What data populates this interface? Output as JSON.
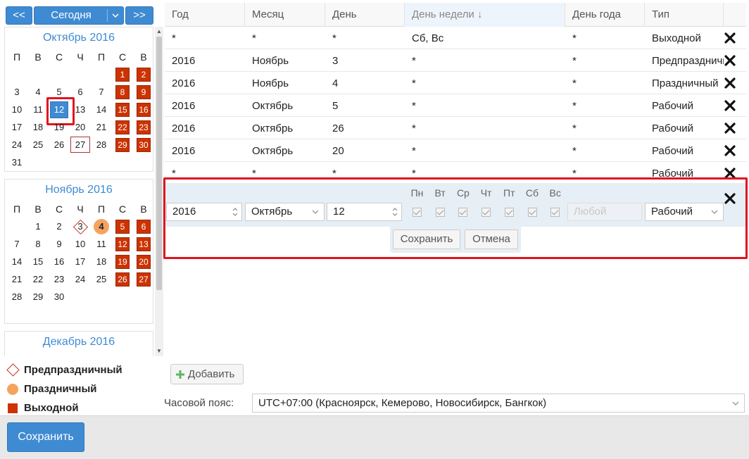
{
  "nav": {
    "prev": "<<",
    "today": "Сегодня",
    "next": ">>"
  },
  "weekday_headers": [
    "П",
    "В",
    "С",
    "Ч",
    "П",
    "С",
    "В"
  ],
  "months": [
    {
      "title": "Октябрь 2016",
      "days": [
        {
          "d": "",
          "t": ""
        },
        {
          "d": "",
          "t": ""
        },
        {
          "d": "",
          "t": ""
        },
        {
          "d": "",
          "t": ""
        },
        {
          "d": "",
          "t": ""
        },
        {
          "d": "1",
          "t": "weekend"
        },
        {
          "d": "2",
          "t": "weekend"
        },
        {
          "d": "3",
          "t": ""
        },
        {
          "d": "4",
          "t": ""
        },
        {
          "d": "5",
          "t": ""
        },
        {
          "d": "6",
          "t": ""
        },
        {
          "d": "7",
          "t": ""
        },
        {
          "d": "8",
          "t": "weekend"
        },
        {
          "d": "9",
          "t": "weekend"
        },
        {
          "d": "10",
          "t": ""
        },
        {
          "d": "11",
          "t": ""
        },
        {
          "d": "12",
          "t": "sel"
        },
        {
          "d": "13",
          "t": ""
        },
        {
          "d": "14",
          "t": ""
        },
        {
          "d": "15",
          "t": "weekend"
        },
        {
          "d": "16",
          "t": "weekend"
        },
        {
          "d": "17",
          "t": ""
        },
        {
          "d": "18",
          "t": ""
        },
        {
          "d": "19",
          "t": ""
        },
        {
          "d": "20",
          "t": ""
        },
        {
          "d": "21",
          "t": ""
        },
        {
          "d": "22",
          "t": "weekend"
        },
        {
          "d": "23",
          "t": "weekend"
        },
        {
          "d": "24",
          "t": ""
        },
        {
          "d": "25",
          "t": ""
        },
        {
          "d": "26",
          "t": ""
        },
        {
          "d": "27",
          "t": "today"
        },
        {
          "d": "28",
          "t": ""
        },
        {
          "d": "29",
          "t": "weekend"
        },
        {
          "d": "30",
          "t": "weekend"
        },
        {
          "d": "31",
          "t": ""
        }
      ]
    },
    {
      "title": "Ноябрь 2016",
      "days": [
        {
          "d": "",
          "t": ""
        },
        {
          "d": "1",
          "t": ""
        },
        {
          "d": "2",
          "t": ""
        },
        {
          "d": "3",
          "t": "preh"
        },
        {
          "d": "4",
          "t": "holi"
        },
        {
          "d": "5",
          "t": "weekend"
        },
        {
          "d": "6",
          "t": "weekend"
        },
        {
          "d": "7",
          "t": ""
        },
        {
          "d": "8",
          "t": ""
        },
        {
          "d": "9",
          "t": ""
        },
        {
          "d": "10",
          "t": ""
        },
        {
          "d": "11",
          "t": ""
        },
        {
          "d": "12",
          "t": "weekend"
        },
        {
          "d": "13",
          "t": "weekend"
        },
        {
          "d": "14",
          "t": ""
        },
        {
          "d": "15",
          "t": ""
        },
        {
          "d": "16",
          "t": ""
        },
        {
          "d": "17",
          "t": ""
        },
        {
          "d": "18",
          "t": ""
        },
        {
          "d": "19",
          "t": "weekend"
        },
        {
          "d": "20",
          "t": "weekend"
        },
        {
          "d": "21",
          "t": ""
        },
        {
          "d": "22",
          "t": ""
        },
        {
          "d": "23",
          "t": ""
        },
        {
          "d": "24",
          "t": ""
        },
        {
          "d": "25",
          "t": ""
        },
        {
          "d": "26",
          "t": "weekend"
        },
        {
          "d": "27",
          "t": "weekend"
        },
        {
          "d": "28",
          "t": ""
        },
        {
          "d": "29",
          "t": ""
        },
        {
          "d": "30",
          "t": ""
        }
      ]
    },
    {
      "title": "Декабрь 2016",
      "days": []
    }
  ],
  "legend": {
    "preholiday": "Предпраздничный",
    "holiday": "Праздничный",
    "weekend": "Выходной"
  },
  "table": {
    "columns": {
      "year": "Год",
      "month": "Месяц",
      "day": "День",
      "weekday": "День недели ↓",
      "yearday": "День года",
      "type": "Тип"
    },
    "rows": [
      {
        "year": "*",
        "month": "*",
        "day": "*",
        "weekday": "Сб, Вс",
        "yearday": "*",
        "type": "Выходной"
      },
      {
        "year": "2016",
        "month": "Ноябрь",
        "day": "3",
        "weekday": "*",
        "yearday": "*",
        "type": "Предпраздничный"
      },
      {
        "year": "2016",
        "month": "Ноябрь",
        "day": "4",
        "weekday": "*",
        "yearday": "*",
        "type": "Праздничный"
      },
      {
        "year": "2016",
        "month": "Октябрь",
        "day": "5",
        "weekday": "*",
        "yearday": "*",
        "type": "Рабочий"
      },
      {
        "year": "2016",
        "month": "Октябрь",
        "day": "26",
        "weekday": "*",
        "yearday": "*",
        "type": "Рабочий"
      },
      {
        "year": "2016",
        "month": "Октябрь",
        "day": "20",
        "weekday": "*",
        "yearday": "*",
        "type": "Рабочий"
      },
      {
        "year": "*",
        "month": "*",
        "day": "*",
        "weekday": "*",
        "yearday": "*",
        "type": "Рабочий"
      }
    ]
  },
  "editor": {
    "year": "2016",
    "month": "Октябрь",
    "day": "12",
    "weekdays": [
      "Пн",
      "Вт",
      "Ср",
      "Чт",
      "Пт",
      "Сб",
      "Вс"
    ],
    "yearday_placeholder": "Любой",
    "type": "Рабочий",
    "save": "Сохранить",
    "cancel": "Отмена"
  },
  "footer": {
    "add": "Добавить",
    "tz_label": "Часовой пояс:",
    "tz_value": "UTC+07:00 (Красноярск, Кемерово, Новосибирск, Бангкок)",
    "save": "Сохранить"
  },
  "colors": {
    "accent": "#3f8bd3",
    "weekend": "#cc3300",
    "holiday": "#f4a460",
    "highlight": "#e0141e"
  }
}
